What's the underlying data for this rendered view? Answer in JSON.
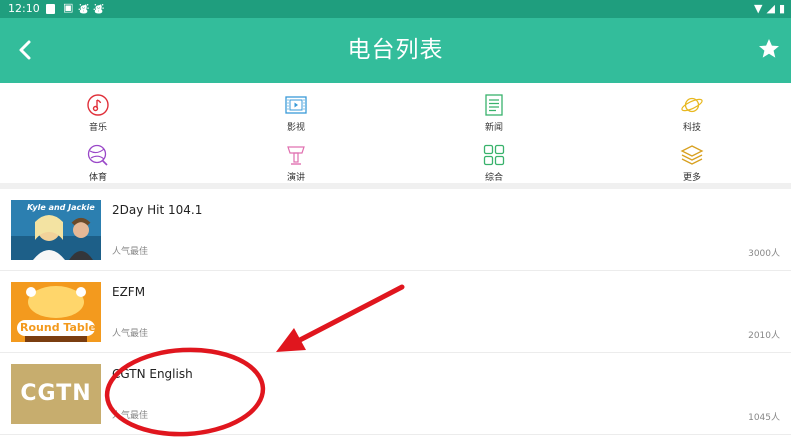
{
  "status_bar": {
    "time": "12:10",
    "icons": [
      "square-icon",
      "image-icon",
      "android-icon",
      "android-icon",
      "wifi-icon",
      "no-signal-icon",
      "battery-icon"
    ]
  },
  "app_bar": {
    "title": "电台列表",
    "back_icon": "back-arrow-icon",
    "favorite_icon": "star-icon"
  },
  "categories": [
    {
      "label": "音乐",
      "icon": "music-icon",
      "color": "#e0303a"
    },
    {
      "label": "影视",
      "icon": "film-icon",
      "color": "#3a9ad8"
    },
    {
      "label": "新闻",
      "icon": "news-icon",
      "color": "#39b26c"
    },
    {
      "label": "科技",
      "icon": "planet-icon",
      "color": "#e8b820"
    },
    {
      "label": "体育",
      "icon": "sports-icon",
      "color": "#9a48c8"
    },
    {
      "label": "演讲",
      "icon": "podium-icon",
      "color": "#e070b0"
    },
    {
      "label": "综合",
      "icon": "grid-icon",
      "color": "#39b26c"
    },
    {
      "label": "更多",
      "icon": "layers-icon",
      "color": "#d8a020"
    }
  ],
  "stations": [
    {
      "name": "2Day Hit 104.1",
      "tag": "人气最佳",
      "count": "3000人",
      "logo_text": "Kyle and Jackie",
      "thumb": "hosts-photo"
    },
    {
      "name": "EZFM",
      "tag": "人气最佳",
      "count": "2010人",
      "logo_text": "Round Table",
      "thumb": "round-table-logo"
    },
    {
      "name": "CGTN English",
      "tag": "人气最佳",
      "count": "1045人",
      "logo_text": "CGTN",
      "thumb": "cgtn-logo"
    }
  ],
  "colors": {
    "status_bar": "#1f9e7e",
    "app_bar": "#33bd9b",
    "annotation": "#e0161e"
  },
  "annotation": {
    "shapes": [
      "red-arrow",
      "red-ellipse"
    ],
    "target": "CGTN English"
  }
}
